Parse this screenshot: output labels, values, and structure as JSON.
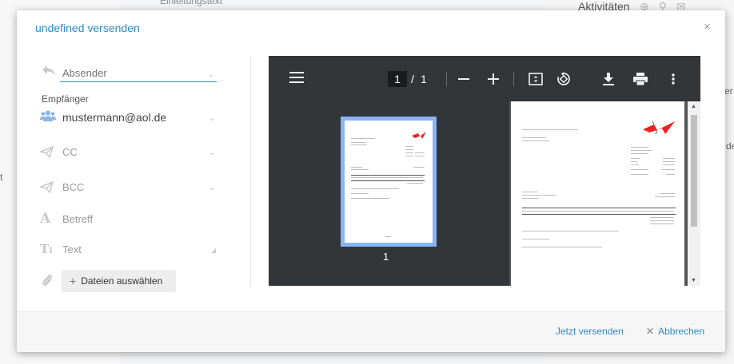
{
  "background": {
    "top_text": "Einleitungstext",
    "activities_label": "Aktivitäten",
    "side_fragments": [
      "t",
      "er",
      "de"
    ]
  },
  "dialog": {
    "title": "undefined versenden",
    "close_symbol": "×"
  },
  "form": {
    "sender_placeholder": "Absender",
    "recipients_label": "Empfänger",
    "recipient_email": "mustermann@aol.de",
    "cc_label": "CC",
    "bcc_label": "BCC",
    "subject_label": "Betreff",
    "text_label": "Text",
    "attach_button_label": "Dateien auswählen"
  },
  "pdf_viewer": {
    "current_page": "1",
    "page_separator": "/",
    "total_pages": "1",
    "thumbnail_number": "1"
  },
  "footer": {
    "send_label": "Jetzt versenden",
    "cancel_label": "Abbrechen"
  },
  "colors": {
    "accent": "#2e8bc9",
    "toolbar_bg": "#323639",
    "thumb_highlight": "#8ab4f8"
  }
}
